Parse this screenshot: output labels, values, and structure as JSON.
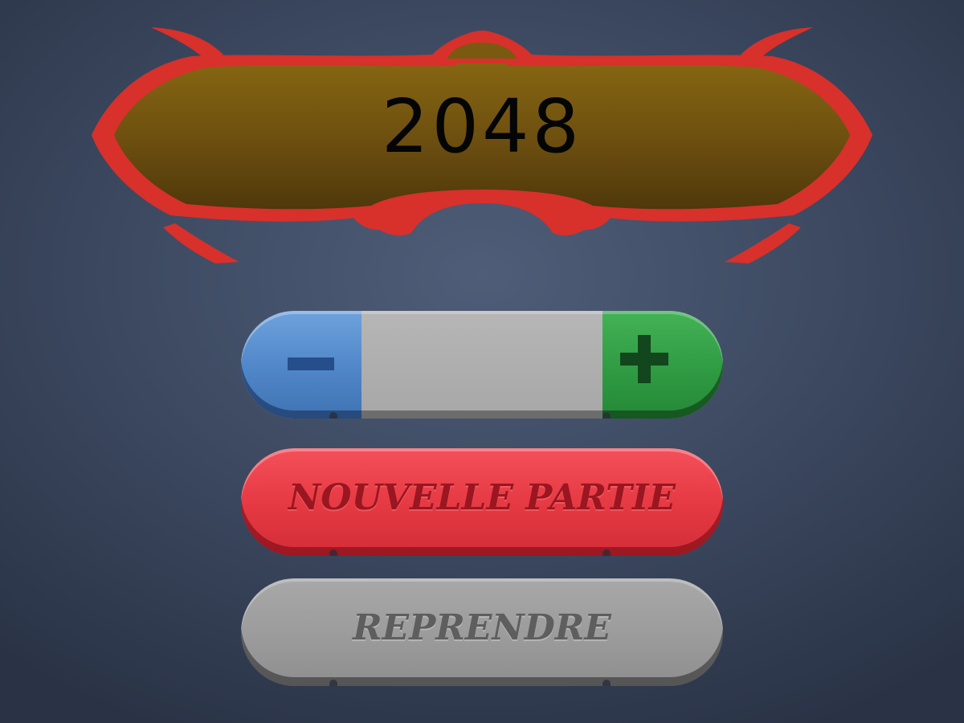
{
  "game": {
    "title": "2048"
  },
  "stepper": {
    "minus_icon": "minus-icon",
    "plus_icon": "plus-icon",
    "value": ""
  },
  "buttons": {
    "new_game_label": "NOUVELLE PARTIE",
    "resume_label": "REPRENDRE"
  },
  "colors": {
    "background": "#3e4b63",
    "banner_fill": "#7a5a10",
    "banner_frame": "#d8302b",
    "minus": "#4f86c8",
    "plus": "#2f9b43",
    "new_game": "#e63a44",
    "resume": "#9b9b9b"
  }
}
